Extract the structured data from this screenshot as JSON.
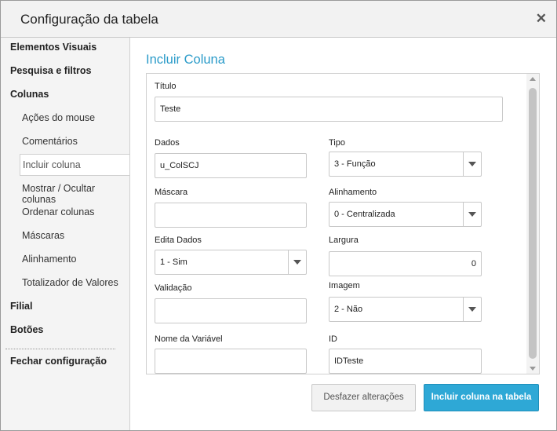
{
  "window": {
    "title": "Configuração da tabela",
    "close_glyph": "✕"
  },
  "sidebar": {
    "items": [
      {
        "label": "Elementos Visuais"
      },
      {
        "label": "Pesquisa e filtros"
      },
      {
        "label": "Colunas"
      },
      {
        "label": "Ações do mouse"
      },
      {
        "label": "Comentários"
      },
      {
        "label": "Incluir coluna"
      },
      {
        "label": "Mostrar / Ocultar colunas"
      },
      {
        "label": "Ordenar colunas"
      },
      {
        "label": "Máscaras"
      },
      {
        "label": "Alinhamento"
      },
      {
        "label": "Totalizador de Valores"
      },
      {
        "label": "Filial"
      },
      {
        "label": "Botões"
      },
      {
        "label": "Fechar configuração"
      }
    ]
  },
  "main": {
    "section_title": "Incluir Coluna",
    "form": {
      "titulo": {
        "label": "Título",
        "value": "Teste"
      },
      "dados": {
        "label": "Dados",
        "value": "u_ColSCJ"
      },
      "tipo": {
        "label": "Tipo",
        "value": "3 - Função"
      },
      "mascara": {
        "label": "Máscara",
        "value": ""
      },
      "alinhamento": {
        "label": "Alinhamento",
        "value": "0 - Centralizada"
      },
      "edita_dados": {
        "label": "Edita Dados",
        "value": "1 - Sim"
      },
      "largura": {
        "label": "Largura",
        "value": "0"
      },
      "validacao": {
        "label": "Validação",
        "value": ""
      },
      "imagem": {
        "label": "Imagem",
        "value": "2 - Não"
      },
      "nome_variavel": {
        "label": "Nome da Variável",
        "value": ""
      },
      "id": {
        "label": "ID",
        "value": "IDTeste"
      }
    },
    "buttons": {
      "undo": "Desfazer alterações",
      "submit": "Incluir coluna na tabela"
    }
  },
  "colors": {
    "accent": "#2ea8d6",
    "title": "#2a9bc9"
  }
}
